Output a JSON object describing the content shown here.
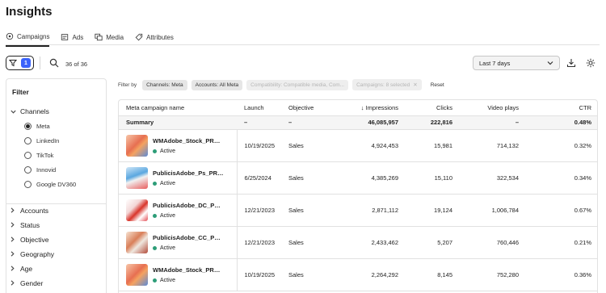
{
  "page": {
    "title": "Insights"
  },
  "tabs": [
    {
      "label": "Campaigns",
      "icon": "campaign-icon",
      "active": true
    },
    {
      "label": "Ads",
      "icon": "ads-icon",
      "active": false
    },
    {
      "label": "Media",
      "icon": "media-icon",
      "active": false
    },
    {
      "label": "Attributes",
      "icon": "attributes-icon",
      "active": false
    }
  ],
  "toolbar": {
    "filter_count": "1",
    "result_count": "36 of 36",
    "date_range": "Last 7 days"
  },
  "filter_panel": {
    "title": "Filter",
    "channels_label": "Channels",
    "channels": [
      {
        "label": "Meta",
        "selected": true
      },
      {
        "label": "LinkedIn",
        "selected": false
      },
      {
        "label": "TikTok",
        "selected": false
      },
      {
        "label": "Innovid",
        "selected": false
      },
      {
        "label": "Google DV360",
        "selected": false
      }
    ],
    "sections": [
      "Accounts",
      "Status",
      "Objective",
      "Geography",
      "Age",
      "Gender"
    ]
  },
  "filter_bar": {
    "label": "Filter by",
    "chips": [
      {
        "text": "Channels: Meta",
        "disabled": false
      },
      {
        "text": "Accounts: All Meta",
        "disabled": false
      },
      {
        "text": "Compatibility: Compatible media, Com...",
        "disabled": true
      },
      {
        "text": "Campaigns: 8 selected",
        "disabled": true
      }
    ],
    "reset": "Reset"
  },
  "table": {
    "headers": {
      "name": "Meta campaign name",
      "launch": "Launch",
      "objective": "Objective",
      "impressions": "Impressions",
      "clicks": "Clicks",
      "video_plays": "Video plays",
      "ctr": "CTR"
    },
    "summary": {
      "label": "Summary",
      "launch": "–",
      "objective": "–",
      "impressions": "46,085,957",
      "clicks": "222,816",
      "video_plays": "–",
      "ctr": "0.48%"
    },
    "rows": [
      {
        "name": "WMAdobe_Stock_PROR...",
        "status": "Active",
        "launch": "10/19/2025",
        "objective": "Sales",
        "impressions": "4,924,453",
        "clicks": "15,981",
        "video_plays": "714,132",
        "ctr": "0.32%"
      },
      {
        "name": "PublicisAdobe_Ps_PRO_...",
        "status": "Active",
        "launch": "6/25/2024",
        "objective": "Sales",
        "impressions": "4,385,269",
        "clicks": "15,110",
        "video_plays": "322,534",
        "ctr": "0.34%"
      },
      {
        "name": "PublicisAdobe_DC_PRO...",
        "status": "Active",
        "launch": "12/21/2023",
        "objective": "Sales",
        "impressions": "2,871,112",
        "clicks": "19,124",
        "video_plays": "1,006,784",
        "ctr": "0.67%"
      },
      {
        "name": "PublicisAdobe_CC_PRO_...",
        "status": "Active",
        "launch": "12/21/2023",
        "objective": "Sales",
        "impressions": "2,433,462",
        "clicks": "5,207",
        "video_plays": "760,446",
        "ctr": "0.21%"
      },
      {
        "name": "WMAdobe_Stock_PROR...",
        "status": "Active",
        "launch": "10/19/2025",
        "objective": "Sales",
        "impressions": "2,264,292",
        "clicks": "8,145",
        "video_plays": "752,280",
        "ctr": "0.36%"
      }
    ]
  },
  "colors": {
    "accent": "#3b63fb",
    "active_status": "#2d9d78"
  }
}
